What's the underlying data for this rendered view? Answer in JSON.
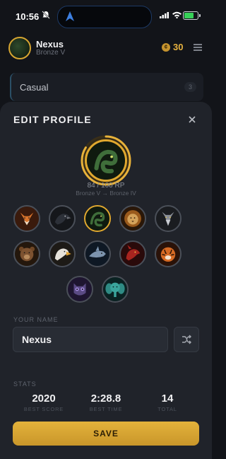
{
  "status_bar": {
    "time": "10:56"
  },
  "header": {
    "player_name": "Nexus",
    "rank": "Bronze V",
    "coins": "30"
  },
  "behind_list": {
    "item_label": "Casual",
    "item_count": "3"
  },
  "sheet": {
    "title": "EDIT PROFILE",
    "progress": {
      "text": "84 / 100 RP",
      "rank_progress": "Bronze V → Bronze IV",
      "fraction": 0.84
    },
    "avatars": [
      {
        "name": "fox",
        "selected": false
      },
      {
        "name": "raven",
        "selected": false
      },
      {
        "name": "serpent",
        "selected": true
      },
      {
        "name": "lion",
        "selected": false
      },
      {
        "name": "wolf",
        "selected": false
      },
      {
        "name": "bear",
        "selected": false
      },
      {
        "name": "eagle",
        "selected": false
      },
      {
        "name": "shark",
        "selected": false
      },
      {
        "name": "dragon",
        "selected": false
      },
      {
        "name": "tiger",
        "selected": false
      },
      {
        "name": "owl",
        "selected": false
      },
      {
        "name": "elephant",
        "selected": false
      }
    ],
    "name_label": "YOUR NAME",
    "name_value": "Nexus",
    "stats_label": "STATS",
    "stats": [
      {
        "value": "2020",
        "label": "BEST SCORE"
      },
      {
        "value": "2:28.8",
        "label": "BEST TIME"
      },
      {
        "value": "14",
        "label": "TOTAL"
      }
    ],
    "save_label": "SAVE"
  },
  "colors": {
    "accent": "#e0a82e",
    "background": "#121419",
    "sheet": "#20232a"
  }
}
